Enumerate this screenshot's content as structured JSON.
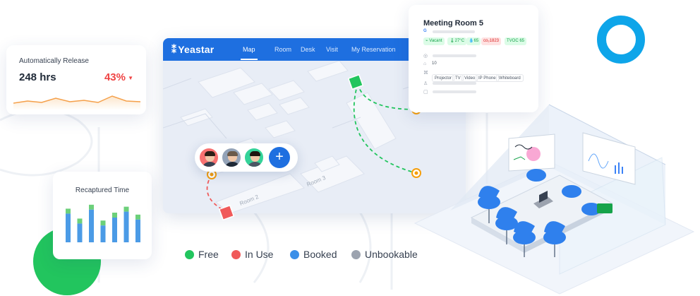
{
  "auto_release": {
    "title": "Automatically Release",
    "hours": "248 hrs",
    "percent": "43%",
    "trend": "down"
  },
  "recaptured": {
    "title": "Recaptured Time",
    "bars": [
      0.85,
      0.6,
      0.95,
      0.55,
      0.75,
      0.9,
      0.7
    ]
  },
  "app": {
    "brand": "Yeastar",
    "nav": [
      "Map",
      "Room",
      "Desk",
      "Visit",
      "My Reservation"
    ],
    "active_nav": "Map",
    "map_labels": [
      "Room 3",
      "Room 2"
    ]
  },
  "room_card": {
    "title": "Meeting Room 5",
    "status": "Vacant",
    "temperature": "27°C",
    "humidity": "65",
    "co2": "co₂1823",
    "tvoc": "TVOC 65",
    "capacity": "10",
    "equipment": [
      "Projector",
      "TV",
      "Video",
      "IP Phone",
      "Whiteboard"
    ]
  },
  "legend": [
    {
      "label": "Free",
      "color": "#22c55e"
    },
    {
      "label": "In Use",
      "color": "#f05a5a"
    },
    {
      "label": "Booked",
      "color": "#3b8fe8"
    },
    {
      "label": "Unbookable",
      "color": "#9ca3af"
    }
  ]
}
